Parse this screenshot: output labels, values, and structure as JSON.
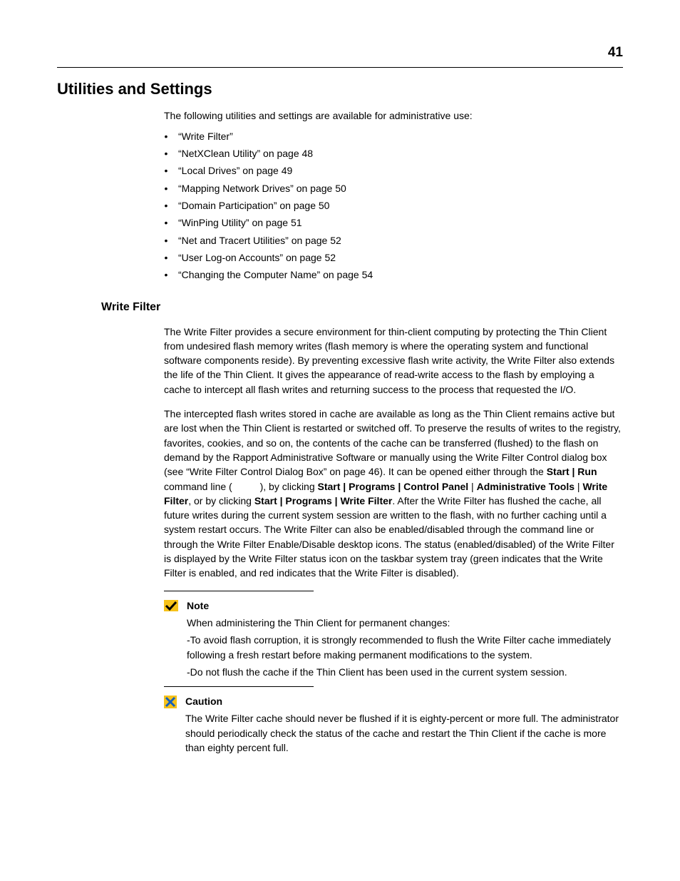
{
  "page_number": "41",
  "heading": "Utilities and Settings",
  "intro": "The following utilities and settings are available for administrative use:",
  "bullets": [
    "“Write Filter”",
    "“NetXClean Utility” on page 48",
    "“Local Drives” on page 49",
    "“Mapping Network Drives” on page 50",
    "“Domain Participation” on page 50",
    "“WinPing Utility” on page 51",
    "“Net and Tracert Utilities” on page 52",
    "“User Log-on Accounts” on page 52",
    "“Changing the Computer Name” on page 54"
  ],
  "subheading": "Write Filter",
  "para1": "The Write Filter provides a secure environment for thin-client computing by protecting the Thin Client from undesired flash memory writes (flash memory is where the operating system and functional software components reside). By preventing excessive flash write activity, the Write Filter also extends the life of the Thin Client. It gives the appearance of read-write access to the flash by employing a cache to intercept all flash writes and returning success to the process that requested the I/O.",
  "para2": {
    "seg1": "The intercepted flash writes stored in cache are available as long as the Thin Client remains active but are lost when the Thin Client is restarted or switched off. To preserve the results of writes to the registry, favorites, cookies, and so on, the contents of the cache can be transferred (flushed) to the flash on demand by the Rapport Administrative Software or manually using the Write Filter Control dialog box (see “Write Filter Control Dialog Box” on page 46). It can be opened either through the ",
    "bold1": "Start | Run",
    "seg2": " command line (          ), by clicking ",
    "bold2": "Start | Programs | Control Panel",
    "seg3": " | ",
    "bold3": "Administrative Tools",
    "seg4": " | ",
    "bold4": "Write Filter",
    "seg5": ", or by clicking ",
    "bold5": "Start | Programs | Write Filter",
    "seg6": ". After the Write Filter has flushed the cache, all future writes during the current system session are written to the flash, with no further caching until a system restart occurs. The Write Filter can also be enabled/disabled through the command line or through the Write Filter Enable/Disable desktop icons. The status (enabled/disabled) of the Write Filter is displayed by the Write Filter status icon on the taskbar system tray (green indicates that the Write Filter is enabled, and red indicates that the Write Filter is disabled)."
  },
  "note": {
    "title": "Note",
    "line1": "When administering the Thin Client for permanent changes:",
    "line2": "-To avoid flash corruption, it is strongly recommended to flush the Write Filter cache immediately following a fresh restart before making permanent modifications to the system.",
    "line3": "-Do not flush the cache if the Thin Client has been used in the current system session."
  },
  "caution": {
    "title": "Caution",
    "text": "The Write Filter cache should never be flushed if it is eighty-percent or more full. The administrator should periodically check the status of the cache and restart the Thin Client if the cache is more than eighty percent full."
  }
}
